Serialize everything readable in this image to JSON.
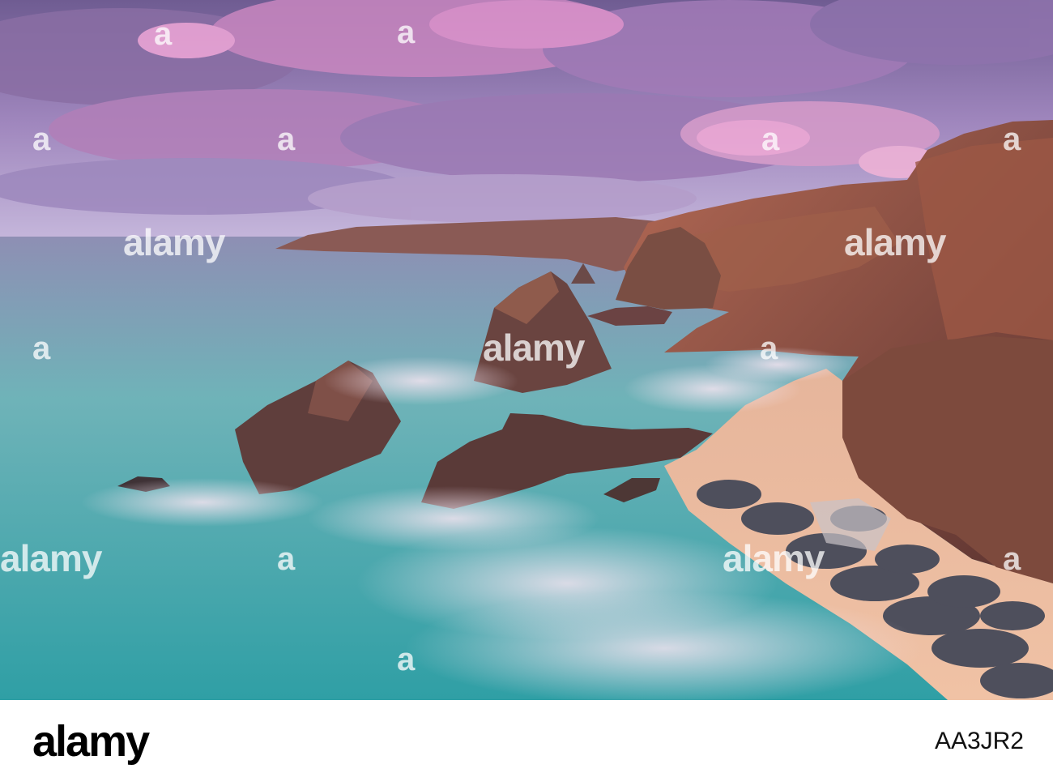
{
  "watermark": {
    "text": "alamy"
  },
  "footer": {
    "logo": "alamy",
    "image_id": "AA3JR2"
  },
  "colors": {
    "sky_top": "#7d6a9e",
    "cloud_pink": "#d88fc6",
    "sea": "#4fb3b2",
    "cliff": "#8a4f3c",
    "sand": "#e9b59a",
    "footer_bg": "#ffffff"
  }
}
